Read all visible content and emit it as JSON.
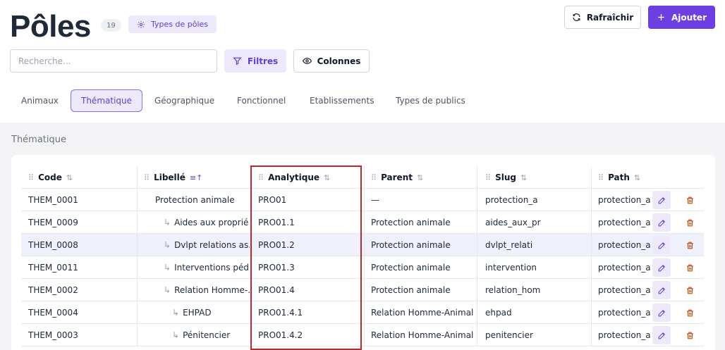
{
  "header": {
    "title": "Pôles",
    "count": "19",
    "types_button": "Types de pôles",
    "refresh_button": "Rafraîchir",
    "add_button": "Ajouter"
  },
  "toolbar": {
    "search_placeholder": "Recherche...",
    "filters_button": "Filtres",
    "columns_button": "Colonnes"
  },
  "tabs": [
    {
      "label": "Animaux",
      "active": false
    },
    {
      "label": "Thématique",
      "active": true
    },
    {
      "label": "Géographique",
      "active": false
    },
    {
      "label": "Fonctionnel",
      "active": false
    },
    {
      "label": "Etablissements",
      "active": false
    },
    {
      "label": "Types de publics",
      "active": false
    }
  ],
  "section_label": "Thématique",
  "table": {
    "columns": [
      "Code",
      "Libellé",
      "Analytique",
      "Parent",
      "Slug",
      "Path"
    ],
    "rows": [
      {
        "code": "THEM_0001",
        "libelle": "Protection animale",
        "depth": 0,
        "analytique": "PRO01",
        "parent": "—",
        "slug": "protection_a",
        "path": "protection_a"
      },
      {
        "code": "THEM_0009",
        "libelle": "Aides aux proprié...",
        "depth": 1,
        "analytique": "PRO01.1",
        "parent": "Protection animale",
        "slug": "aides_aux_pr",
        "path": "protection_a"
      },
      {
        "code": "THEM_0008",
        "libelle": "Dvlpt relations as...",
        "depth": 1,
        "analytique": "PRO01.2",
        "parent": "Protection animale",
        "slug": "dvlpt_relati",
        "path": "protection_a"
      },
      {
        "code": "THEM_0011",
        "libelle": "Interventions péd...",
        "depth": 1,
        "analytique": "PRO01.3",
        "parent": "Protection animale",
        "slug": "intervention",
        "path": "protection_a"
      },
      {
        "code": "THEM_0002",
        "libelle": "Relation Homme-...",
        "depth": 1,
        "analytique": "PRO01.4",
        "parent": "Protection animale",
        "slug": "relation_hom",
        "path": "protection_a"
      },
      {
        "code": "THEM_0004",
        "libelle": "EHPAD",
        "depth": 2,
        "analytique": "PRO01.4.1",
        "parent": "Relation Homme-Animal",
        "slug": "ehpad",
        "path": "protection_a"
      },
      {
        "code": "THEM_0003",
        "libelle": "Pénitencier",
        "depth": 2,
        "analytique": "PRO01.4.2",
        "parent": "Relation Homme-Animal",
        "slug": "penitencier",
        "path": "protection_a"
      }
    ],
    "highlighted_row": 2
  },
  "colors": {
    "accent": "#6d3fe0",
    "accent_soft": "#ede9fb",
    "danger": "#c2410c",
    "annotation": "#c0272d"
  },
  "icons": {
    "types": "gear-icon",
    "refresh": "refresh-icon",
    "add": "plus-icon",
    "filters": "filter-icon",
    "columns": "eye-icon",
    "row_edit": "edit-icon",
    "row_delete": "trash-icon"
  }
}
